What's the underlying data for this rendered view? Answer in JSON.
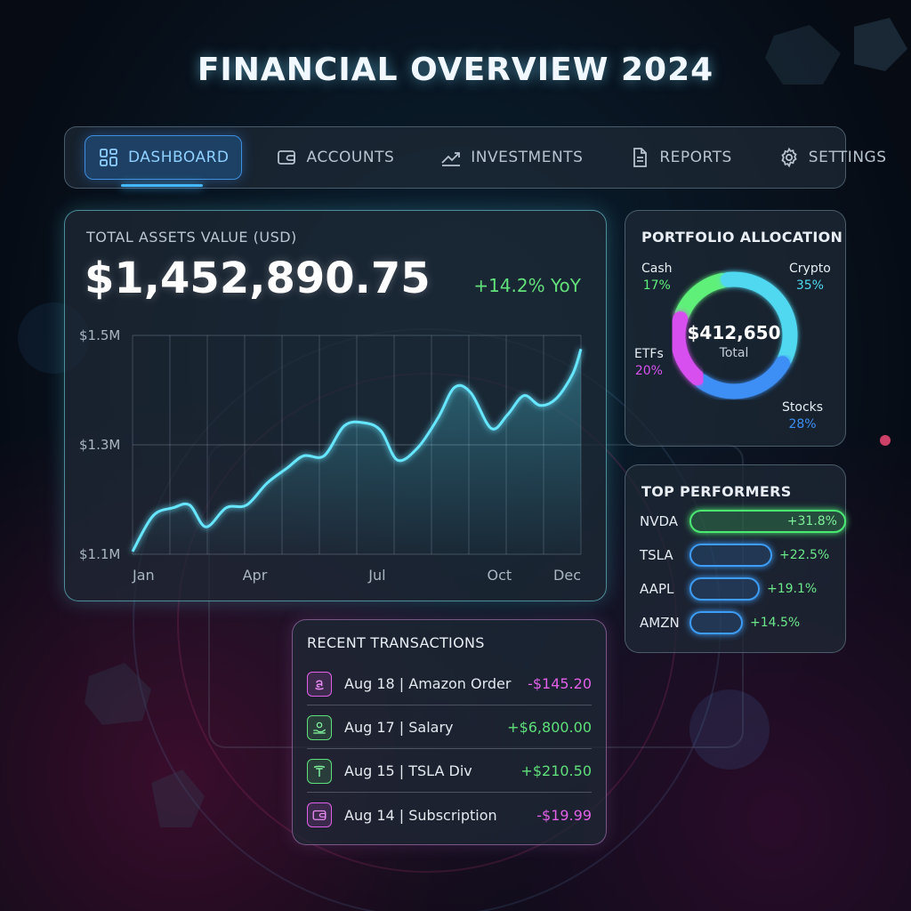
{
  "page": {
    "title": "FINANCIAL OVERVIEW 2024"
  },
  "nav": {
    "items": [
      {
        "label": "DASHBOARD",
        "icon": "dashboard-grid-icon",
        "active": true
      },
      {
        "label": "ACCOUNTS",
        "icon": "wallet-icon",
        "active": false
      },
      {
        "label": "INVESTMENTS",
        "icon": "trend-up-icon",
        "active": false
      },
      {
        "label": "REPORTS",
        "icon": "document-icon",
        "active": false
      },
      {
        "label": "SETTINGS",
        "icon": "gear-icon",
        "active": false
      }
    ]
  },
  "assets": {
    "label": "TOTAL ASSETS VALUE (USD)",
    "value": "$1,452,890.75",
    "yoy": "+14.2% YoY"
  },
  "chart_data": {
    "type": "area",
    "title": "",
    "xlabel": "",
    "ylabel": "",
    "x_ticks": [
      "Jan",
      "Apr",
      "Jul",
      "Oct",
      "Dec"
    ],
    "y_ticks": [
      "$1.5M",
      "$1.3M",
      "$1.1M"
    ],
    "ylim": [
      1.1,
      1.5
    ],
    "grid": true,
    "series": [
      {
        "x": [
          0,
          0.5,
          1,
          1.4,
          1.8,
          2.3,
          2.8,
          3.3,
          3.8,
          4.2,
          4.7,
          5.2,
          5.7,
          6.1,
          6.5,
          7.0,
          7.5,
          7.9,
          8.3,
          8.8,
          9.2,
          9.6,
          10.0,
          10.4,
          10.8,
          11.0
        ],
        "y": [
          1.105,
          1.17,
          1.185,
          1.19,
          1.15,
          1.185,
          1.19,
          1.23,
          1.258,
          1.28,
          1.28,
          1.335,
          1.34,
          1.325,
          1.272,
          1.295,
          1.35,
          1.405,
          1.395,
          1.33,
          1.355,
          1.39,
          1.372,
          1.385,
          1.43,
          1.475
        ],
        "color": "#66e6ff"
      }
    ]
  },
  "portfolio": {
    "title": "PORTFOLIO ALLOCATION",
    "total_value": "$412,650",
    "total_label": "Total",
    "chart_data": {
      "type": "pie",
      "slices": [
        {
          "name": "Cash",
          "pct": "17%",
          "value": 17,
          "color": "#5ff07a"
        },
        {
          "name": "Crypto",
          "pct": "35%",
          "value": 35,
          "color": "#4fd8f0"
        },
        {
          "name": "Stocks",
          "pct": "28%",
          "value": 28,
          "color": "#3d8ff5"
        },
        {
          "name": "ETFs",
          "pct": "20%",
          "value": 20,
          "color": "#d850f0"
        }
      ]
    }
  },
  "performers": {
    "title": "TOP PERFORMERS",
    "items": [
      {
        "ticker": "NVDA",
        "value": "+31.8%",
        "pct": 31.8,
        "color": "#4ce874"
      },
      {
        "ticker": "TSLA",
        "value": "+22.5%",
        "pct": 22.5,
        "color": "#3d9cf5"
      },
      {
        "ticker": "AAPL",
        "value": "+19.1%",
        "pct": 19.1,
        "color": "#3d9cf5"
      },
      {
        "ticker": "AMZN",
        "value": "+14.5%",
        "pct": 14.5,
        "color": "#3d9cf5"
      }
    ]
  },
  "transactions": {
    "title": "RECENT TRANSACTIONS",
    "items": [
      {
        "text": "Aug 18 | Amazon Order",
        "amount": "-$145.20",
        "icon": "amazon-icon",
        "color": "#e061e8"
      },
      {
        "text": "Aug 17 | Salary",
        "amount": "+$6,800.00",
        "icon": "salary-hand-icon",
        "color": "#5fe07a"
      },
      {
        "text": "Aug 15 | TSLA Div",
        "amount": "+$210.50",
        "icon": "tesla-icon",
        "color": "#5fe07a"
      },
      {
        "text": "Aug 14 | Subscription",
        "amount": "-$19.99",
        "icon": "wallet-icon",
        "color": "#e061e8"
      }
    ]
  }
}
